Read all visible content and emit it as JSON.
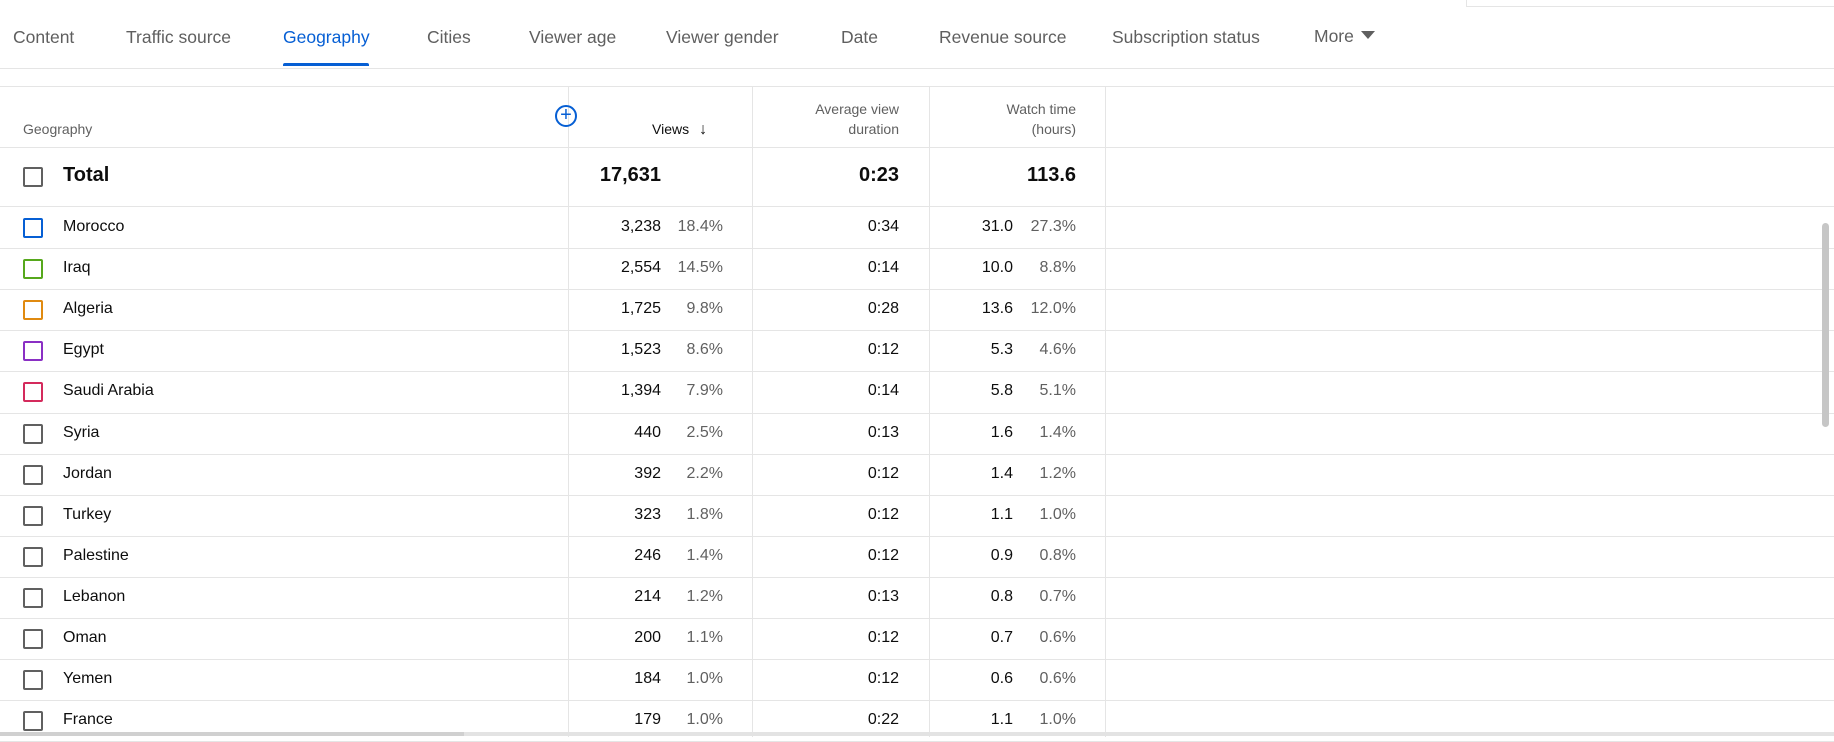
{
  "tabs": [
    {
      "label": "Content",
      "active": false
    },
    {
      "label": "Traffic source",
      "active": false
    },
    {
      "label": "Geography",
      "active": true
    },
    {
      "label": "Cities",
      "active": false
    },
    {
      "label": "Viewer age",
      "active": false
    },
    {
      "label": "Viewer gender",
      "active": false
    },
    {
      "label": "Date",
      "active": false
    },
    {
      "label": "Revenue source",
      "active": false
    },
    {
      "label": "Subscription status",
      "active": false
    },
    {
      "label": "More",
      "active": false
    }
  ],
  "colors": {
    "accent": "#065fd4"
  },
  "table": {
    "headers": {
      "geography": "Geography",
      "views": "Views",
      "avg_duration_line1": "Average view",
      "avg_duration_line2": "duration",
      "watch_time_line1": "Watch time",
      "watch_time_line2": "(hours)"
    },
    "sort_icon": "arrow-down-icon",
    "add_column_icon": "plus-circle-icon",
    "total": {
      "label": "Total",
      "views": "17,631",
      "avg": "0:23",
      "watch": "113.6"
    },
    "rows": [
      {
        "name": "Morocco",
        "views": "3,238",
        "pct": "18.4%",
        "avg": "0:34",
        "watch": "31.0",
        "watch_pct": "27.3%",
        "color": "#065fd4"
      },
      {
        "name": "Iraq",
        "views": "2,554",
        "pct": "14.5%",
        "avg": "0:14",
        "watch": "10.0",
        "watch_pct": "8.8%",
        "color": "#56a81c"
      },
      {
        "name": "Algeria",
        "views": "1,725",
        "pct": "9.8%",
        "avg": "0:28",
        "watch": "13.6",
        "watch_pct": "12.0%",
        "color": "#e08a10"
      },
      {
        "name": "Egypt",
        "views": "1,523",
        "pct": "8.6%",
        "avg": "0:12",
        "watch": "5.3",
        "watch_pct": "4.6%",
        "color": "#8a2fc4"
      },
      {
        "name": "Saudi Arabia",
        "views": "1,394",
        "pct": "7.9%",
        "avg": "0:14",
        "watch": "5.8",
        "watch_pct": "5.1%",
        "color": "#d42a5c"
      },
      {
        "name": "Syria",
        "views": "440",
        "pct": "2.5%",
        "avg": "0:13",
        "watch": "1.6",
        "watch_pct": "1.4%",
        "color": "#606060"
      },
      {
        "name": "Jordan",
        "views": "392",
        "pct": "2.2%",
        "avg": "0:12",
        "watch": "1.4",
        "watch_pct": "1.2%",
        "color": "#606060"
      },
      {
        "name": "Turkey",
        "views": "323",
        "pct": "1.8%",
        "avg": "0:12",
        "watch": "1.1",
        "watch_pct": "1.0%",
        "color": "#606060"
      },
      {
        "name": "Palestine",
        "views": "246",
        "pct": "1.4%",
        "avg": "0:12",
        "watch": "0.9",
        "watch_pct": "0.8%",
        "color": "#606060"
      },
      {
        "name": "Lebanon",
        "views": "214",
        "pct": "1.2%",
        "avg": "0:13",
        "watch": "0.8",
        "watch_pct": "0.7%",
        "color": "#606060"
      },
      {
        "name": "Oman",
        "views": "200",
        "pct": "1.1%",
        "avg": "0:12",
        "watch": "0.7",
        "watch_pct": "0.6%",
        "color": "#606060"
      },
      {
        "name": "Yemen",
        "views": "184",
        "pct": "1.0%",
        "avg": "0:12",
        "watch": "0.6",
        "watch_pct": "0.6%",
        "color": "#606060"
      },
      {
        "name": "France",
        "views": "179",
        "pct": "1.0%",
        "avg": "0:22",
        "watch": "1.1",
        "watch_pct": "1.0%",
        "color": "#606060"
      }
    ]
  }
}
